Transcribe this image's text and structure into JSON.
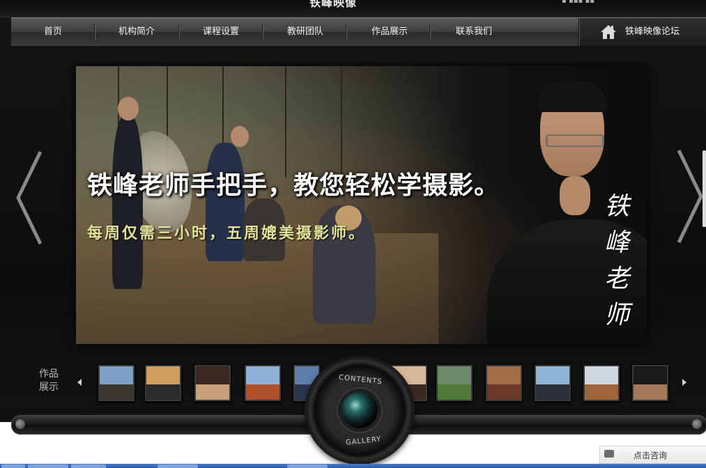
{
  "header": {
    "logo_text": "铁峰映像",
    "top_icons_text": "▪ ▪▪▪ ▪▪"
  },
  "nav": {
    "items": [
      {
        "label": "首页"
      },
      {
        "label": "机构简介"
      },
      {
        "label": "课程设置"
      },
      {
        "label": "教研团队"
      },
      {
        "label": "作品展示"
      },
      {
        "label": "联系我们"
      }
    ],
    "forum": {
      "label": "铁峰映像论坛",
      "icon": "home-icon"
    }
  },
  "banner": {
    "headline": "铁峰老师手把手，教您轻松学摄影。",
    "subline": "每周仅需三小时，五周媲美摄影师。",
    "signature": "铁峰老师",
    "prev_icon": "chevron-left-icon",
    "next_icon": "chevron-right-icon"
  },
  "gallery": {
    "label_line1": "作品",
    "label_line2": "展示",
    "lens_text_top": "CONTENTS",
    "lens_text_bottom": "GALLERY",
    "thumbs": [
      {
        "name": "palace",
        "sky": "#7d9fc4",
        "land": "#3a3630"
      },
      {
        "name": "sunset-lake",
        "sky": "#d0a060",
        "land": "#2b2b2b"
      },
      {
        "name": "portrait-man",
        "sky": "#3b2a20",
        "land": "#caa07a"
      },
      {
        "name": "pagoda",
        "sky": "#8fb0d8",
        "land": "#b0502a"
      },
      {
        "name": "mountain",
        "sky": "#5c7da8",
        "land": "#2a3550"
      },
      {
        "name": "photographer-silhouette",
        "sky": "#d7b79a",
        "land": "#3a2a22"
      },
      {
        "name": "green-field",
        "sky": "#6c8a6a",
        "land": "#4f7a3a"
      },
      {
        "name": "praying-child",
        "sky": "#a46d4a",
        "land": "#6b3828"
      },
      {
        "name": "bird",
        "sky": "#8fb6d6",
        "land": "#2a2f3a"
      },
      {
        "name": "potala",
        "sky": "#cfd6e0",
        "land": "#a0643a"
      },
      {
        "name": "portrait-elder",
        "sky": "#1a1a1a",
        "land": "#a47a5a"
      }
    ]
  },
  "footer": {
    "consult_label": "点击咨询",
    "consult_icon": "chat-icon"
  }
}
